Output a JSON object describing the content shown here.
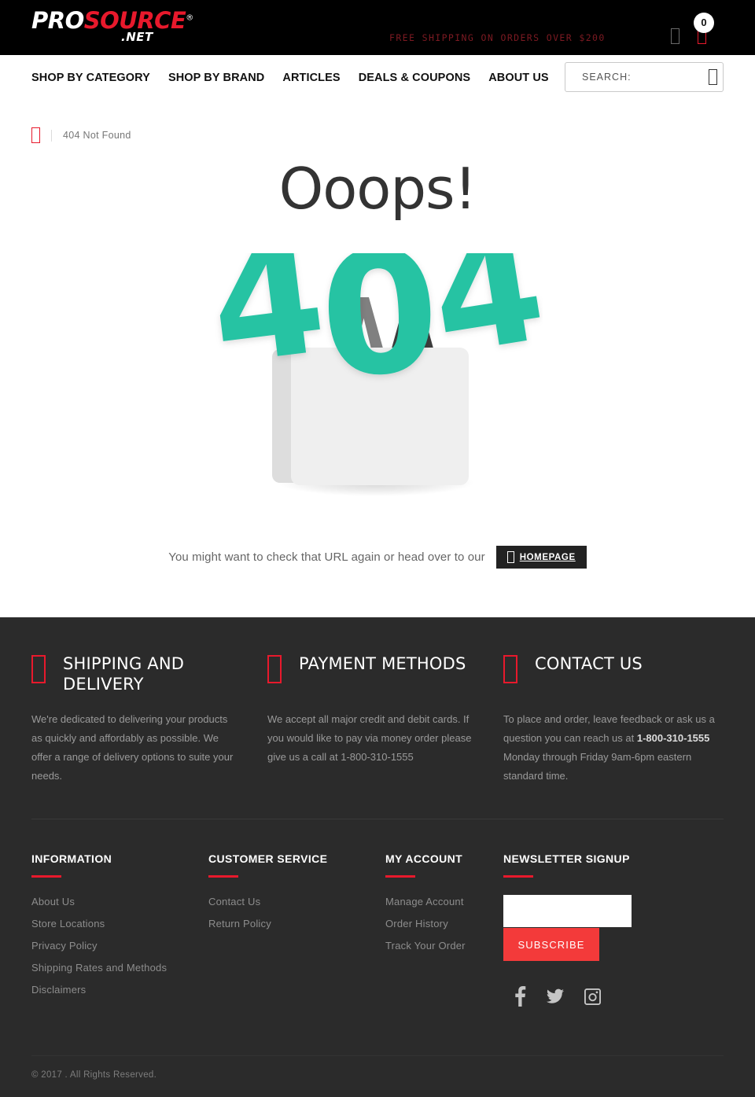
{
  "header": {
    "logo": {
      "part1": "PRO",
      "part2": "SOURCE",
      "registered": "®",
      "tld": ".NET"
    },
    "shipping_banner": "FREE SHIPPING ON ORDERS OVER $200",
    "account_icon": "user-icon",
    "cart_icon": "cart-icon",
    "cart_count": "0",
    "nav": [
      {
        "label": "SHOP BY CATEGORY"
      },
      {
        "label": "SHOP BY BRAND"
      },
      {
        "label": "ARTICLES"
      },
      {
        "label": "DEALS & COUPONS"
      },
      {
        "label": "ABOUT US"
      }
    ],
    "search": {
      "placeholder": "SEARCH:",
      "value": "",
      "button_icon": "search-icon"
    }
  },
  "breadcrumb": {
    "home_icon": "home-icon",
    "current": "404 Not Found"
  },
  "error_page": {
    "heading": "Ooops!",
    "graphic": {
      "name": "404-shopping-bag-illustration",
      "digits": "404",
      "bag_color": "#eeeeee",
      "bag_side_color": "#dddddd",
      "digit_color": "#27c3a3",
      "handle_color_left": "#808080",
      "handle_color_right": "#3d3d3d"
    },
    "helper_text": "You might want to check that URL again or head over to our",
    "home_button": {
      "label": "HOMEPAGE",
      "icon": "home-icon"
    }
  },
  "footer": {
    "features": [
      {
        "icon": "truck-icon",
        "title": "SHIPPING AND DELIVERY",
        "body": "We're dedicated to delivering your products as quickly and affordably as possible. We offer a range of delivery options to suite your needs."
      },
      {
        "icon": "credit-card-icon",
        "title": "PAYMENT METHODS",
        "body": "We accept all major credit and debit cards. If you would like to pay via money order please give us a call at 1-800-310-1555"
      },
      {
        "icon": "phone-icon",
        "title": "CONTACT US",
        "body_pre": "To place and order, leave feedback or ask us a question you can reach us at ",
        "body_phone": "1-800-310-1555",
        "body_post": " Monday through Friday 9am-6pm eastern standard time."
      }
    ],
    "columns": [
      {
        "title": "INFORMATION",
        "links": [
          "About Us",
          "Store Locations",
          "Privacy Policy",
          "Shipping Rates and Methods",
          "Disclaimers"
        ]
      },
      {
        "title": "CUSTOMER SERVICE",
        "links": [
          "Contact Us",
          "Return Policy"
        ]
      },
      {
        "title": "MY ACCOUNT",
        "links": [
          "Manage Account",
          "Order History",
          "Track Your Order"
        ]
      }
    ],
    "newsletter": {
      "title": "NEWSLETTER SIGNUP",
      "input_value": "",
      "input_placeholder": "",
      "button_label": "SUBSCRIBE"
    },
    "socials": [
      {
        "name": "facebook-icon",
        "label": "Facebook"
      },
      {
        "name": "twitter-icon",
        "label": "Twitter"
      },
      {
        "name": "instagram-icon",
        "label": "Instagram"
      }
    ],
    "copyright": "© 2017 . All Rights Reserved."
  },
  "colors": {
    "brand_red": "#e8192c",
    "subscribe_red": "#f33a3a",
    "teal": "#27c3a3",
    "footer_bg": "#2b2b2b",
    "topbar_bg": "#000000"
  }
}
